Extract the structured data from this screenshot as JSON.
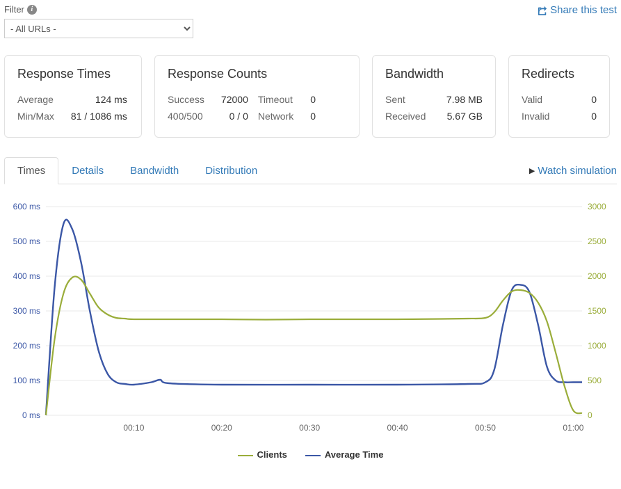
{
  "filter": {
    "label": "Filter",
    "selected": "- All URLs -"
  },
  "share_label": "Share this test",
  "cards": {
    "response_times": {
      "title": "Response Times",
      "rows": [
        {
          "label": "Average",
          "value": "124 ms"
        },
        {
          "label": "Min/Max",
          "value": "81 / 1086 ms"
        }
      ]
    },
    "response_counts": {
      "title": "Response Counts",
      "rows_left": [
        {
          "label": "Success",
          "value": "72000"
        },
        {
          "label": "400/500",
          "value": "0 / 0"
        }
      ],
      "rows_right": [
        {
          "label": "Timeout",
          "value": "0"
        },
        {
          "label": "Network",
          "value": "0"
        }
      ]
    },
    "bandwidth": {
      "title": "Bandwidth",
      "rows": [
        {
          "label": "Sent",
          "value": "7.98 MB"
        },
        {
          "label": "Received",
          "value": "5.67 GB"
        }
      ]
    },
    "redirects": {
      "title": "Redirects",
      "rows": [
        {
          "label": "Valid",
          "value": "0"
        },
        {
          "label": "Invalid",
          "value": "0"
        }
      ]
    }
  },
  "tabs": {
    "items": [
      "Times",
      "Details",
      "Bandwidth",
      "Distribution"
    ],
    "active": "Times"
  },
  "watch_label": "Watch simulation",
  "legend": {
    "left": "Clients",
    "right": "Average Time"
  },
  "chart_data": {
    "type": "line",
    "xlabel": "",
    "ylabel_left": "ms",
    "ylabel_right": "clients",
    "x_ticks": [
      "00:10",
      "00:20",
      "00:30",
      "00:40",
      "00:50",
      "01:00"
    ],
    "y_left_ticks": [
      "0 ms",
      "100 ms",
      "200 ms",
      "300 ms",
      "400 ms",
      "500 ms",
      "600 ms"
    ],
    "y_right_ticks": [
      "0",
      "500",
      "1000",
      "1500",
      "2000",
      "2500",
      "3000"
    ],
    "ylim_left": [
      0,
      600
    ],
    "ylim_right": [
      0,
      3000
    ],
    "xlim_sec": [
      0,
      61
    ],
    "series": [
      {
        "name": "Average Time",
        "axis": "left",
        "color": "#3b57a6",
        "points": [
          {
            "t": 0,
            "v": 0
          },
          {
            "t": 1,
            "v": 370
          },
          {
            "t": 2,
            "v": 550
          },
          {
            "t": 3,
            "v": 535
          },
          {
            "t": 4,
            "v": 440
          },
          {
            "t": 5,
            "v": 300
          },
          {
            "t": 6,
            "v": 185
          },
          {
            "t": 7,
            "v": 120
          },
          {
            "t": 8,
            "v": 95
          },
          {
            "t": 9,
            "v": 90
          },
          {
            "t": 10,
            "v": 88
          },
          {
            "t": 12,
            "v": 95
          },
          {
            "t": 13,
            "v": 102
          },
          {
            "t": 14,
            "v": 92
          },
          {
            "t": 20,
            "v": 88
          },
          {
            "t": 30,
            "v": 88
          },
          {
            "t": 40,
            "v": 88
          },
          {
            "t": 48,
            "v": 90
          },
          {
            "t": 50,
            "v": 95
          },
          {
            "t": 51,
            "v": 130
          },
          {
            "t": 52,
            "v": 260
          },
          {
            "t": 53,
            "v": 360
          },
          {
            "t": 54,
            "v": 375
          },
          {
            "t": 55,
            "v": 355
          },
          {
            "t": 56,
            "v": 260
          },
          {
            "t": 57,
            "v": 140
          },
          {
            "t": 58,
            "v": 100
          },
          {
            "t": 59,
            "v": 95
          },
          {
            "t": 60,
            "v": 95
          },
          {
            "t": 61,
            "v": 95
          }
        ]
      },
      {
        "name": "Clients",
        "axis": "right",
        "color": "#9aad3a",
        "points": [
          {
            "t": 0,
            "v": 0
          },
          {
            "t": 1,
            "v": 1100
          },
          {
            "t": 2,
            "v": 1750
          },
          {
            "t": 3,
            "v": 1980
          },
          {
            "t": 4,
            "v": 1950
          },
          {
            "t": 5,
            "v": 1750
          },
          {
            "t": 6,
            "v": 1550
          },
          {
            "t": 7,
            "v": 1450
          },
          {
            "t": 8,
            "v": 1400
          },
          {
            "t": 9,
            "v": 1390
          },
          {
            "t": 10,
            "v": 1380
          },
          {
            "t": 15,
            "v": 1380
          },
          {
            "t": 20,
            "v": 1380
          },
          {
            "t": 25,
            "v": 1375
          },
          {
            "t": 30,
            "v": 1380
          },
          {
            "t": 35,
            "v": 1380
          },
          {
            "t": 40,
            "v": 1380
          },
          {
            "t": 45,
            "v": 1385
          },
          {
            "t": 48,
            "v": 1390
          },
          {
            "t": 50,
            "v": 1400
          },
          {
            "t": 51,
            "v": 1480
          },
          {
            "t": 52,
            "v": 1650
          },
          {
            "t": 53,
            "v": 1780
          },
          {
            "t": 54,
            "v": 1800
          },
          {
            "t": 55,
            "v": 1760
          },
          {
            "t": 56,
            "v": 1620
          },
          {
            "t": 57,
            "v": 1350
          },
          {
            "t": 58,
            "v": 900
          },
          {
            "t": 59,
            "v": 420
          },
          {
            "t": 60,
            "v": 70
          },
          {
            "t": 61,
            "v": 30
          }
        ]
      }
    ]
  }
}
